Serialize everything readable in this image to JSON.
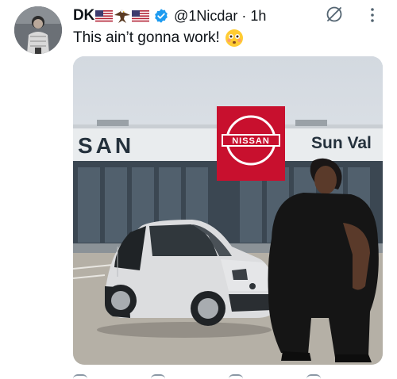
{
  "post": {
    "display_name": "DK",
    "handle": "@1Nicdar",
    "separator": " · ",
    "time": "1h",
    "text": "This ain’t gonna work!"
  },
  "media": {
    "dealership_sign_left": "SAN",
    "dealership_sign_right": "Sun Val",
    "brand_sign": "NISSAN"
  },
  "icons": {
    "avatar": "avatar",
    "flag": "us-flag-icon",
    "eagle": "eagle-icon",
    "verified": "verified-badge-icon",
    "grok": "grok-icon",
    "more": "more-icon",
    "emoji": "flushed-face-emoji"
  },
  "colors": {
    "verified": "#1d9bf0",
    "text": "#0f1419",
    "muted": "#536471",
    "nissan_red": "#c8102e"
  }
}
